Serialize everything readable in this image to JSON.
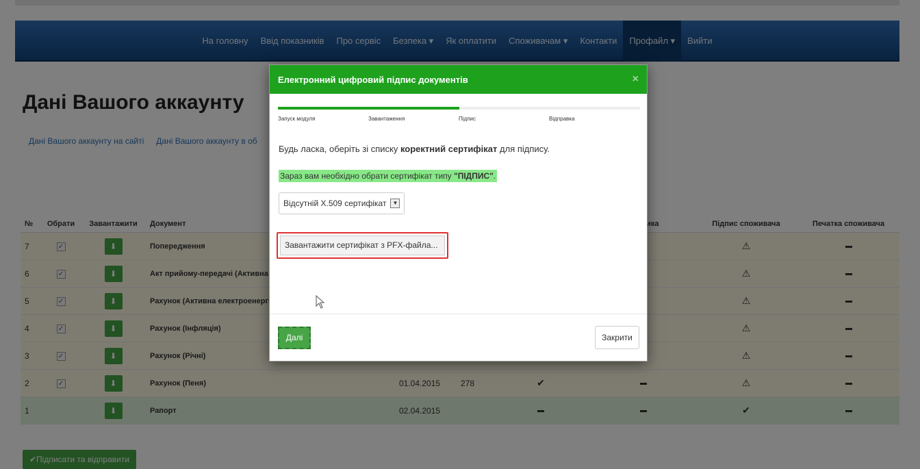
{
  "nav": {
    "items": [
      "На головну",
      "Ввід показників",
      "Про сервіс",
      "Безпека ▾",
      "Як оплатити",
      "Споживачам ▾",
      "Контакти",
      "Профайл ▾",
      "Вийти"
    ]
  },
  "page": {
    "title": "Дані Вашого аккаунту",
    "subtabs": [
      "Дані Вашого аккаунту на сайті",
      "Дані Вашого аккаунту в об"
    ]
  },
  "table": {
    "headers": [
      "№",
      "Обрати",
      "Завантажити",
      "Документ",
      "",
      "",
      "",
      "альника",
      "Підпис споживача",
      "Печатка споживача"
    ],
    "rows": [
      {
        "no": "7",
        "checked": true,
        "doc": "Попередження",
        "date": "",
        "num": "",
        "seal1": "",
        "seal2": "dash",
        "sig": "warning",
        "stamp": "dash",
        "style": "yellow"
      },
      {
        "no": "6",
        "checked": true,
        "doc": "Акт прийому-передачі (Активна ел",
        "date": "",
        "num": "",
        "seal1": "",
        "seal2": "dash",
        "sig": "warning",
        "stamp": "dash",
        "style": "yellow"
      },
      {
        "no": "5",
        "checked": true,
        "doc": "Рахунок (Активна електроенергія (",
        "date": "",
        "num": "",
        "seal1": "",
        "seal2": "dash",
        "sig": "warning",
        "stamp": "dash",
        "style": "yellow"
      },
      {
        "no": "4",
        "checked": true,
        "doc": "Рахунок (Інфляція)",
        "date": "",
        "num": "",
        "seal1": "",
        "seal2": "dash",
        "sig": "warning",
        "stamp": "dash",
        "style": "yellow"
      },
      {
        "no": "3",
        "checked": true,
        "doc": "Рахунок (Річні)",
        "date": "",
        "num": "",
        "seal1": "",
        "seal2": "",
        "sig": "warning",
        "stamp": "dash",
        "style": "yellow"
      },
      {
        "no": "2",
        "checked": true,
        "doc": "Рахунок (Пеня)",
        "date": "01.04.2015",
        "num": "278",
        "seal1": "check",
        "seal2": "dash",
        "sig": "warning",
        "stamp": "dash",
        "style": "yellow"
      },
      {
        "no": "1",
        "checked": false,
        "doc": "Рапорт",
        "date": "02.04.2015",
        "num": "",
        "seal1": "dash",
        "seal2": "dash",
        "sig": "check",
        "stamp": "dash",
        "style": "green"
      }
    ]
  },
  "send_button": "✔Підписати та відправити",
  "modal": {
    "title": "Електронний цифровий підпис документів",
    "close": "×",
    "progress": 0.5,
    "steps": [
      "Запуск модуля",
      "Завантаження",
      "Підпис",
      "Відправка"
    ],
    "text_before": "Будь ласка, оберіть зі списку ",
    "text_bold": "коректний сертифікат",
    "text_after": " для підпису.",
    "hint_before": "Зараз вам необхідно обрати сертифікат типу ",
    "hint_bold": "\"ПІДПИС\"",
    "hint_after": ".",
    "select_value": "Відсутній X.509 сертифікат",
    "load_button": "Завантажити сертифікат з PFX-файла...",
    "next_button": "Далі",
    "close_button": "Закрити"
  },
  "colors": {
    "modal_header": "#1ea21e",
    "navbar": "#1a5290",
    "row_yellow": "#fcf8e3",
    "row_green": "#dff0d8",
    "highlight_border": "#e03030"
  }
}
